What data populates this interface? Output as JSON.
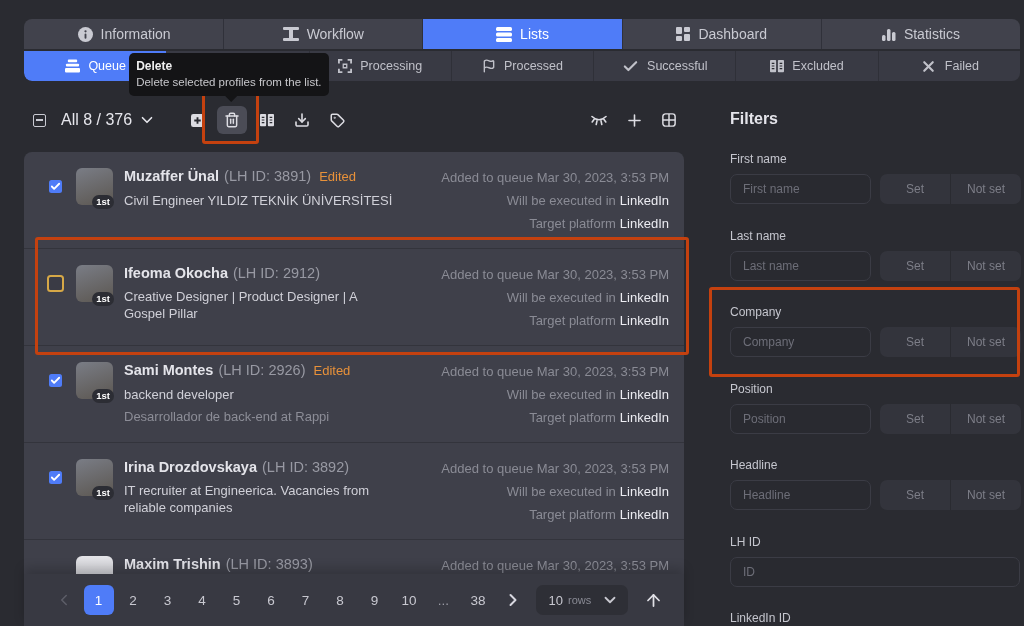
{
  "main_tabs": [
    {
      "label": "Information",
      "selected": false
    },
    {
      "label": "Workflow",
      "selected": false
    },
    {
      "label": "Lists",
      "selected": true
    },
    {
      "label": "Dashboard",
      "selected": false
    },
    {
      "label": "Statistics",
      "selected": false
    }
  ],
  "sub_tabs": [
    {
      "label": "Queue",
      "selected": true
    },
    {
      "label": "Processing",
      "selected": false
    },
    {
      "label": "Processed",
      "selected": false
    },
    {
      "label": "Successful",
      "selected": false
    },
    {
      "label": "Excluded",
      "selected": false
    },
    {
      "label": "Failed",
      "selected": false
    }
  ],
  "toolbar": {
    "select_all_indeterminate": true,
    "selection": "All 8 / 376",
    "actions": [
      {
        "kind": "add",
        "hovered": false,
        "highlighted": false
      },
      {
        "kind": "delete",
        "hovered": true,
        "highlighted": true
      },
      {
        "kind": "exclude",
        "hovered": false,
        "highlighted": false
      },
      {
        "kind": "export",
        "hovered": false,
        "highlighted": false
      },
      {
        "kind": "tag",
        "hovered": false,
        "highlighted": false
      }
    ],
    "view_actions": [
      {
        "kind": "hide"
      },
      {
        "kind": "new"
      },
      {
        "kind": "columns"
      }
    ],
    "tooltip": {
      "title": "Delete",
      "text": "Delete selected profiles from the list."
    }
  },
  "profiles": [
    {
      "name": "Muzaffer Ünal",
      "lh_id": "(LH ID: 3891)",
      "edited": "Edited",
      "degree": "1st",
      "headline": [
        "Civil Engineer YILDIZ TEKNİK ÜNİVERSİTESİ"
      ],
      "checked": true,
      "highlighted": false,
      "added": "Added to queue Mar 30, 2023, 3:53 PM",
      "executed_label": "Will be executed in",
      "executed_platform": "LinkedIn",
      "target_label": "Target platform",
      "target_platform": "LinkedIn"
    },
    {
      "name": "Ifeoma Okocha",
      "lh_id": "(LH ID: 2912)",
      "degree": "1st",
      "headline": [
        "Creative Designer | Product Designer | A",
        "Gospel Pillar"
      ],
      "checked": false,
      "highlighted": true,
      "added": "Added to queue Mar 30, 2023, 3:53 PM",
      "executed_label": "Will be executed in",
      "executed_platform": "LinkedIn",
      "target_label": "Target platform",
      "target_platform": "LinkedIn"
    },
    {
      "name": "Sami Montes",
      "lh_id": "(LH ID: 2926)",
      "edited": "Edited",
      "degree": "1st",
      "headline": [
        "backend developer"
      ],
      "position": "Desarrollador de back-end at Rappi",
      "checked": true,
      "highlighted": false,
      "added": "Added to queue Mar 30, 2023, 3:53 PM",
      "executed_label": "Will be executed in",
      "executed_platform": "LinkedIn",
      "target_label": "Target platform",
      "target_platform": "LinkedIn"
    },
    {
      "name": "Irina Drozdovskaya",
      "lh_id": "(LH ID: 3892)",
      "degree": "1st",
      "headline": [
        "IT recruiter at Engineerica. Vacancies from",
        "reliable companies"
      ],
      "checked": true,
      "highlighted": false,
      "added": "Added to queue Mar 30, 2023, 3:53 PM",
      "executed_label": "Will be executed in",
      "executed_platform": "LinkedIn",
      "target_label": "Target platform",
      "target_platform": "LinkedIn"
    }
  ],
  "cut_off_profile": {
    "name": "Maxim Trishin",
    "lh_id": "(LH ID: 3893)",
    "added": "Added to queue Mar 30, 2023, 3:53 PM"
  },
  "pagination": {
    "previous_disabled": true,
    "pages": [
      {
        "label": "1",
        "selected": true
      },
      {
        "label": "2",
        "selected": false
      },
      {
        "label": "3",
        "selected": false
      },
      {
        "label": "4",
        "selected": false
      },
      {
        "label": "5",
        "selected": false
      },
      {
        "label": "6",
        "selected": false
      },
      {
        "label": "7",
        "selected": false
      },
      {
        "label": "8",
        "selected": false
      },
      {
        "label": "9",
        "selected": false
      },
      {
        "label": "10",
        "selected": false
      }
    ],
    "ellipsis": "...",
    "last_page": {
      "label": "38",
      "selected": false
    },
    "rows_value": "10",
    "rows_unit": "rows"
  },
  "filters": {
    "title": "Filters",
    "fields": [
      {
        "kind": "toggle",
        "label": "First name",
        "placeholder": "First name",
        "set": "Set",
        "not_set": "Not set",
        "highlighted": false
      },
      {
        "kind": "toggle",
        "label": "Last name",
        "placeholder": "Last name",
        "set": "Set",
        "not_set": "Not set",
        "highlighted": false
      },
      {
        "kind": "toggle",
        "label": "Company",
        "placeholder": "Company",
        "set": "Set",
        "not_set": "Not set",
        "highlighted": true
      },
      {
        "kind": "toggle",
        "label": "Position",
        "placeholder": "Position",
        "set": "Set",
        "not_set": "Not set",
        "highlighted": false
      },
      {
        "kind": "toggle",
        "label": "Headline",
        "placeholder": "Headline",
        "set": "Set",
        "not_set": "Not set",
        "highlighted": false
      },
      {
        "kind": "plain",
        "label": "LH ID",
        "placeholder": "ID",
        "highlighted": false
      },
      {
        "kind": "label_only",
        "label": "LinkedIn ID",
        "highlighted": false
      }
    ]
  }
}
